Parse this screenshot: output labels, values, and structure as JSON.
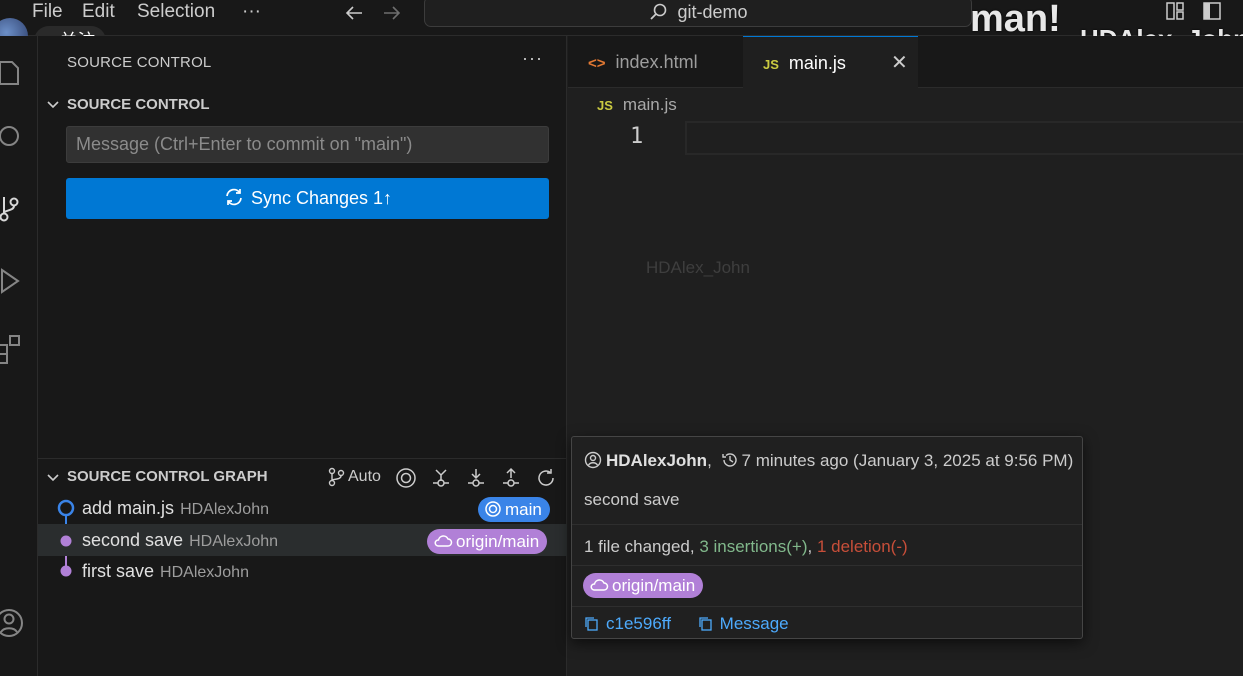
{
  "menu": {
    "file": "File",
    "edit": "Edit",
    "selection": "Selection",
    "more": "···"
  },
  "command_center": {
    "text": "git-demo"
  },
  "overlay": {
    "follow_button": "+ 关注",
    "big_text": "man!",
    "channel": "HDAlex_John"
  },
  "sidebar": {
    "header": "SOURCE CONTROL",
    "more": "···",
    "section_title": "SOURCE CONTROL",
    "message_placeholder": "Message (Ctrl+Enter to commit on \"main\")",
    "sync_button": "Sync Changes 1↑"
  },
  "graph": {
    "title": "SOURCE CONTROL GRAPH",
    "auto_label": "Auto",
    "commits": [
      {
        "message": "add main.js",
        "author": "HDAlexJohn",
        "ref": "main",
        "ref_color": "#3a84e8"
      },
      {
        "message": "second save",
        "author": "HDAlexJohn",
        "ref": "origin/main",
        "ref_color": "#b180d7"
      },
      {
        "message": "first save",
        "author": "HDAlexJohn",
        "ref": "",
        "ref_color": ""
      }
    ]
  },
  "editor": {
    "tabs": [
      {
        "label": "index.html",
        "icon": "html-icon"
      },
      {
        "label": "main.js",
        "icon": "js-icon"
      }
    ],
    "close_glyph": "✕",
    "breadcrumb": "main.js",
    "line_number": "1",
    "watermark": "HDAlex_John"
  },
  "hover_card": {
    "author": "HDAlexJohn",
    "comma": ",",
    "time": "7 minutes ago (January 3, 2025 at 9:56 PM)",
    "message": "second save",
    "files_changed": "1 file changed, ",
    "insertions": "3 insertions(+)",
    "sep": ", ",
    "deletions": "1 deletion(-)",
    "ref": "origin/main",
    "hash": "c1e596ff",
    "message_link": "Message"
  },
  "colors": {
    "accent": "#0078d4",
    "main_ref": "#3a84e8",
    "origin_ref": "#b180d7",
    "insert": "#81b88b",
    "delete": "#c74e39"
  }
}
